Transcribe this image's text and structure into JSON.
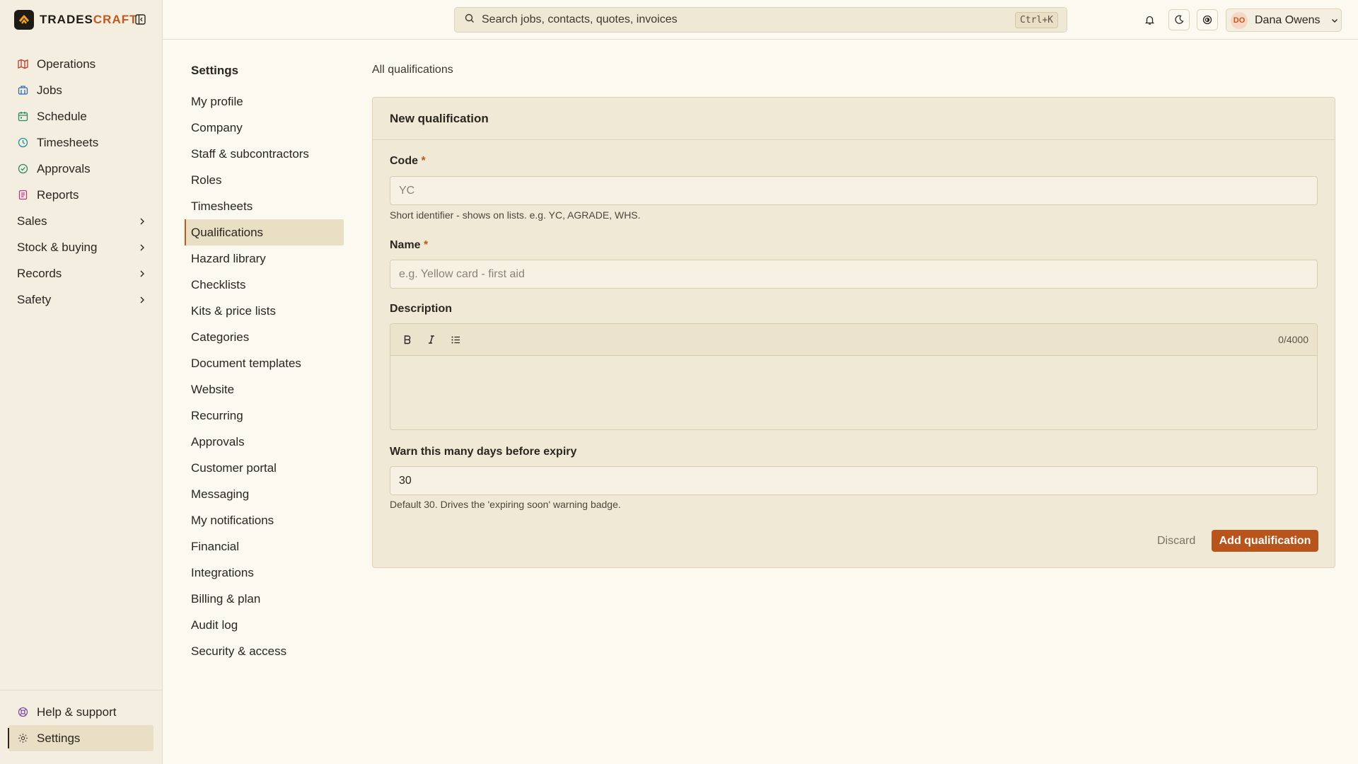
{
  "brand": {
    "name_part1": "TRADES",
    "name_part2": "CRAFT"
  },
  "sidebar": {
    "items": [
      {
        "label": "Operations",
        "icon": "map-icon",
        "color": "#c0392b"
      },
      {
        "label": "Jobs",
        "icon": "building-icon",
        "color": "#2e6db4"
      },
      {
        "label": "Schedule",
        "icon": "calendar-icon",
        "color": "#2e8b57"
      },
      {
        "label": "Timesheets",
        "icon": "clock-icon",
        "color": "#1f8fa0"
      },
      {
        "label": "Approvals",
        "icon": "check-circle-icon",
        "color": "#2e8b57"
      },
      {
        "label": "Reports",
        "icon": "document-icon",
        "color": "#b23a8a"
      }
    ],
    "groups": [
      {
        "label": "Sales"
      },
      {
        "label": "Stock & buying"
      },
      {
        "label": "Records"
      },
      {
        "label": "Safety"
      }
    ],
    "bottom": [
      {
        "label": "Help & support",
        "icon": "lifebuoy-icon"
      },
      {
        "label": "Settings",
        "icon": "gear-icon"
      }
    ]
  },
  "topbar": {
    "search_placeholder": "Search jobs, contacts, quotes, invoices",
    "shortcut": "Ctrl+K",
    "user_initials": "DO",
    "user_name": "Dana Owens"
  },
  "settings": {
    "title": "Settings",
    "items": [
      "My profile",
      "Company",
      "Staff & subcontractors",
      "Roles",
      "Timesheets",
      "Qualifications",
      "Hazard library",
      "Checklists",
      "Kits & price lists",
      "Categories",
      "Document templates",
      "Website",
      "Recurring",
      "Approvals",
      "Customer portal",
      "Messaging",
      "My notifications",
      "Financial",
      "Integrations",
      "Billing & plan",
      "Audit log",
      "Security & access"
    ],
    "active": "Qualifications"
  },
  "main": {
    "breadcrumb": "All qualifications",
    "card_title": "New qualification",
    "code": {
      "label": "Code",
      "required": "*",
      "placeholder": "YC",
      "hint": "Short identifier - shows on lists. e.g. YC, AGRADE, WHS."
    },
    "name": {
      "label": "Name",
      "required": "*",
      "placeholder": "e.g. Yellow card - first aid"
    },
    "description": {
      "label": "Description",
      "counter": "0/4000"
    },
    "warn": {
      "label": "Warn this many days before expiry",
      "value": "30",
      "hint": "Default 30. Drives the 'expiring soon' warning badge."
    },
    "discard_label": "Discard",
    "submit_label": "Add qualification"
  },
  "colors": {
    "accent": "#b8551d",
    "background": "#fcf9f1",
    "sidebar": "#f3eedf"
  }
}
